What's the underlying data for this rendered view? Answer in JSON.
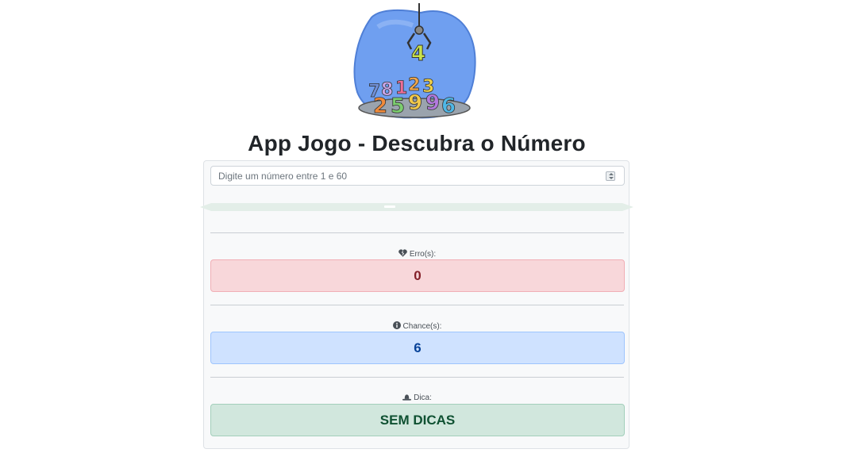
{
  "header": {
    "title": "App Jogo - Descubra o Número"
  },
  "guess_input": {
    "placeholder": "Digite um número entre 1 e 60",
    "value": ""
  },
  "errors": {
    "label": "Erro(s):",
    "value": "0",
    "icon": "heart-broken-icon"
  },
  "chances": {
    "label": "Chance(s):",
    "value": "6",
    "icon": "info-circle-icon"
  },
  "hint": {
    "label": "Dica:",
    "value": "SEM DICAS",
    "icon": "hat-icon"
  },
  "colors": {
    "danger_bg": "#f8d7da",
    "danger_text": "#842029",
    "info_bg": "#cfe2ff",
    "info_text": "#084298",
    "success_bg": "#d1e7dd",
    "success_text": "#0f5132"
  }
}
